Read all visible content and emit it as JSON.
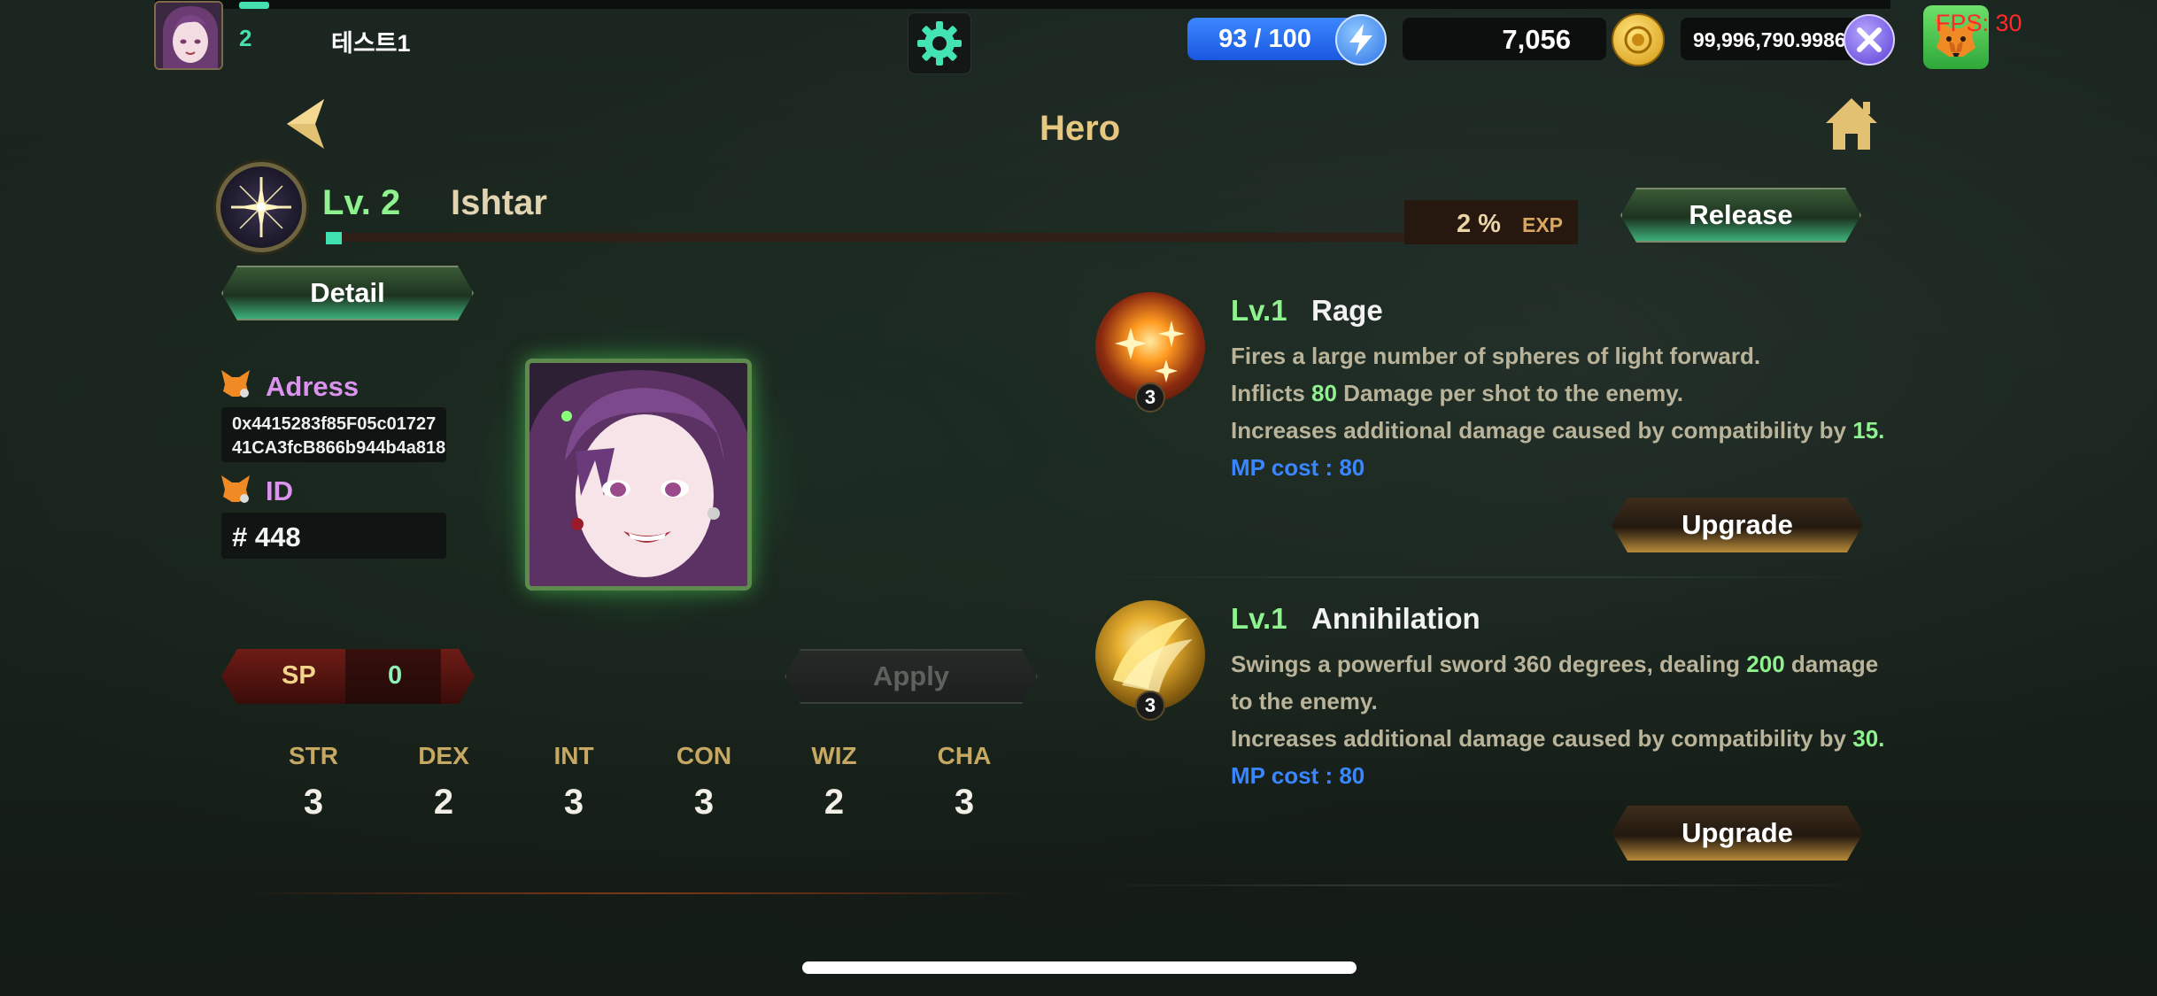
{
  "topbar": {
    "player_level": "2",
    "username": "테스트1",
    "energy": "93 / 100",
    "gold": "7,056",
    "x_token": "99,996,790.9986",
    "fps": "FPS: 30",
    "topline_progress": 0.02
  },
  "header": {
    "title": "Hero"
  },
  "hero": {
    "level": "Lv. 2",
    "name": "Ishtar",
    "exp_percent": "2 %",
    "exp_label": "EXP",
    "exp_progress": 0.02,
    "release_label": "Release",
    "detail_label": "Detail"
  },
  "info": {
    "address_label": "Adress",
    "address_line1": "0x4415283f85F05c01727",
    "address_line2": "41CA3fcB866b944b4a818",
    "id_label": "ID",
    "id_value": "# 448"
  },
  "sp": {
    "label": "SP",
    "value": "0",
    "apply_label": "Apply"
  },
  "stats": [
    {
      "name": "STR",
      "value": "3"
    },
    {
      "name": "DEX",
      "value": "2"
    },
    {
      "name": "INT",
      "value": "3"
    },
    {
      "name": "CON",
      "value": "3"
    },
    {
      "name": "WIZ",
      "value": "2"
    },
    {
      "name": "CHA",
      "value": "3"
    }
  ],
  "skills": [
    {
      "level": "Lv.1",
      "name": "Rage",
      "badge": "3",
      "desc1": "Fires a large number of spheres of light forward.",
      "desc2_pre": "Inflicts ",
      "desc2_hl": "80",
      "desc2_post": " Damage per shot to the enemy.",
      "desc3_pre": "Increases additional damage caused by compatibility by ",
      "desc3_hl": "15.",
      "mp": "MP cost : 80",
      "upgrade_label": "Upgrade"
    },
    {
      "level": "Lv.1",
      "name": "Annihilation",
      "badge": "3",
      "desc1_pre": "Swings a powerful sword 360 degrees, dealing ",
      "desc1_hl": "200",
      "desc1_post": " damage",
      "desc1b": "to the enemy.",
      "desc3_pre": "Increases additional damage caused by compatibility by ",
      "desc3_hl": "30.",
      "mp": "MP cost : 80",
      "upgrade_label": "Upgrade"
    }
  ],
  "colors": {
    "accent_green": "#8ef28e",
    "teal": "#48e0b0",
    "title_gold": "#e7c880",
    "address_pink": "#dc93f0",
    "mp_blue": "#3a86ff"
  },
  "icons": {
    "back": "back-arrow-icon",
    "home": "home-icon",
    "settings": "gear-icon",
    "energy": "lightning-icon",
    "gold": "gold-coin-icon",
    "x_token": "x-token-icon",
    "wallet": "metamask-fox-icon"
  }
}
